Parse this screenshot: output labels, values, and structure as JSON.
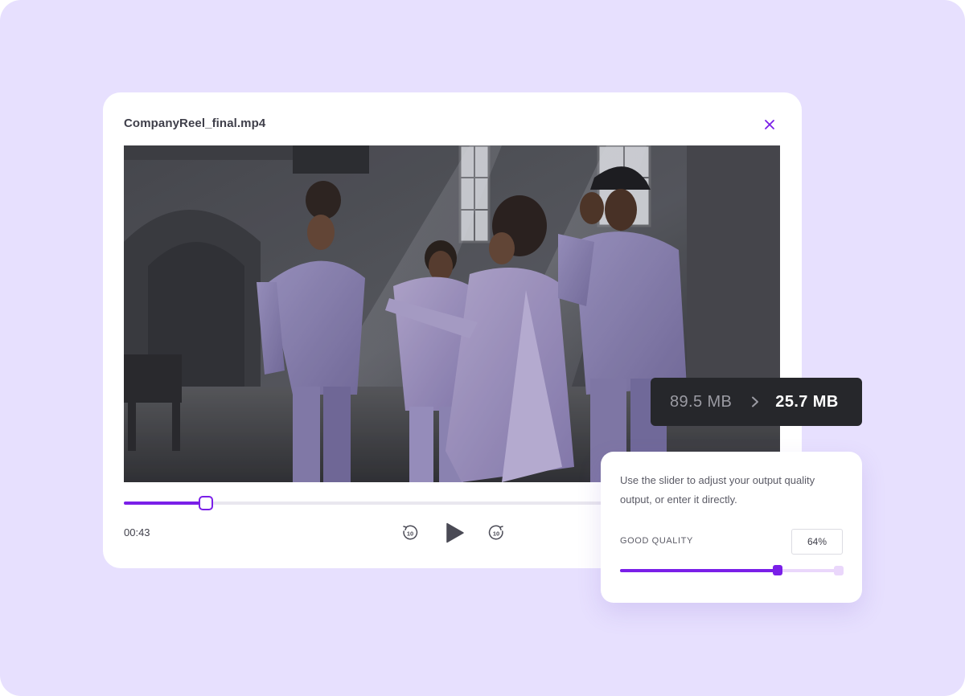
{
  "colors": {
    "accent": "#7a1fe8",
    "page_background": "#e7e0fe",
    "badge_background": "#26272b"
  },
  "player": {
    "title": "CompanyReel_final.mp4",
    "close_icon": "close-icon",
    "current_time": "00:43",
    "progress": 0.16,
    "controls": {
      "rewind_icon": "rewind-10-icon",
      "rewind_label": "10",
      "play_icon": "play-icon",
      "forward_icon": "forward-10-icon",
      "forward_label": "10"
    }
  },
  "size_badge": {
    "original": "89.5 MB",
    "arrow_icon": "chevron-right-icon",
    "compressed": "25.7 MB"
  },
  "quality": {
    "description": "Use the slider to adjust your output quality output, or enter it directly.",
    "label": "GOOD QUALITY",
    "value": "64%",
    "level": 0.72
  }
}
